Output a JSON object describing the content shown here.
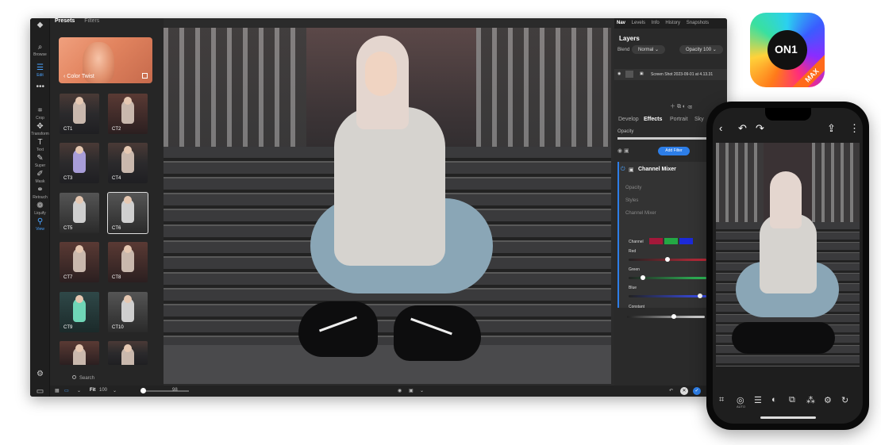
{
  "desktop": {
    "tools": [
      {
        "label": "Browse",
        "icon": "browse-icon"
      },
      {
        "label": "Edit",
        "icon": "sliders-icon",
        "active": true
      },
      {
        "label": "Crop",
        "icon": "crop-icon"
      },
      {
        "label": "Transform",
        "icon": "move-icon"
      },
      {
        "label": "Text",
        "icon": "text-icon"
      },
      {
        "label": "Super",
        "icon": "brush-icon"
      },
      {
        "label": "Mask",
        "icon": "mask-icon"
      },
      {
        "label": "Retouch",
        "icon": "retouch-icon"
      },
      {
        "label": "Liquify",
        "icon": "liquify-icon"
      },
      {
        "label": "View",
        "icon": "view-icon",
        "active": true
      }
    ],
    "presets": {
      "tabs": [
        "Presets",
        "Filters"
      ],
      "hero_label": "Color Twist",
      "thumbs": [
        "CT1",
        "CT2",
        "CT3",
        "CT4",
        "CT5",
        "CT6",
        "CT7",
        "CT8",
        "CT9",
        "CT10"
      ],
      "selected": "CT6",
      "search_placeholder": "Search"
    },
    "bottombar": {
      "fit": "Fit",
      "zoom_value": "100",
      "zoom_level": "98"
    },
    "right_panel": {
      "tabs": [
        "Nav",
        "Levels",
        "Info",
        "History",
        "Snapshots"
      ],
      "layers_title": "Layers",
      "blend_label": "Blend",
      "blend_value": "Normal",
      "opacity_label": "Opacity",
      "opacity_value": "100",
      "layer_name": "Screen Shot 2023-09-01 at 4.13.31",
      "subtabs": [
        "Develop",
        "Effects",
        "Portrait",
        "Sky"
      ],
      "effects_opacity_label": "Opacity",
      "add_filter": "Add Filter",
      "filter_name": "Channel Mixer",
      "filter_sections": [
        "Opacity",
        "Styles",
        "Channel Mixer"
      ],
      "channel_label": "Channel",
      "sliders": [
        {
          "label": "Red",
          "value": 0.5
        },
        {
          "label": "Green",
          "value": 0.18
        },
        {
          "label": "Blue",
          "value": 0.92
        },
        {
          "label": "Constant",
          "value": 0.6
        }
      ],
      "colors": {
        "red": "#a4183a",
        "green": "#23a844",
        "blue": "#1c2ad8",
        "accent": "#2d7ee8"
      }
    }
  },
  "app_icon": {
    "label": "ON1",
    "badge": "MAX"
  },
  "phone": {
    "toolbar_labels": [
      "AUTO"
    ]
  }
}
